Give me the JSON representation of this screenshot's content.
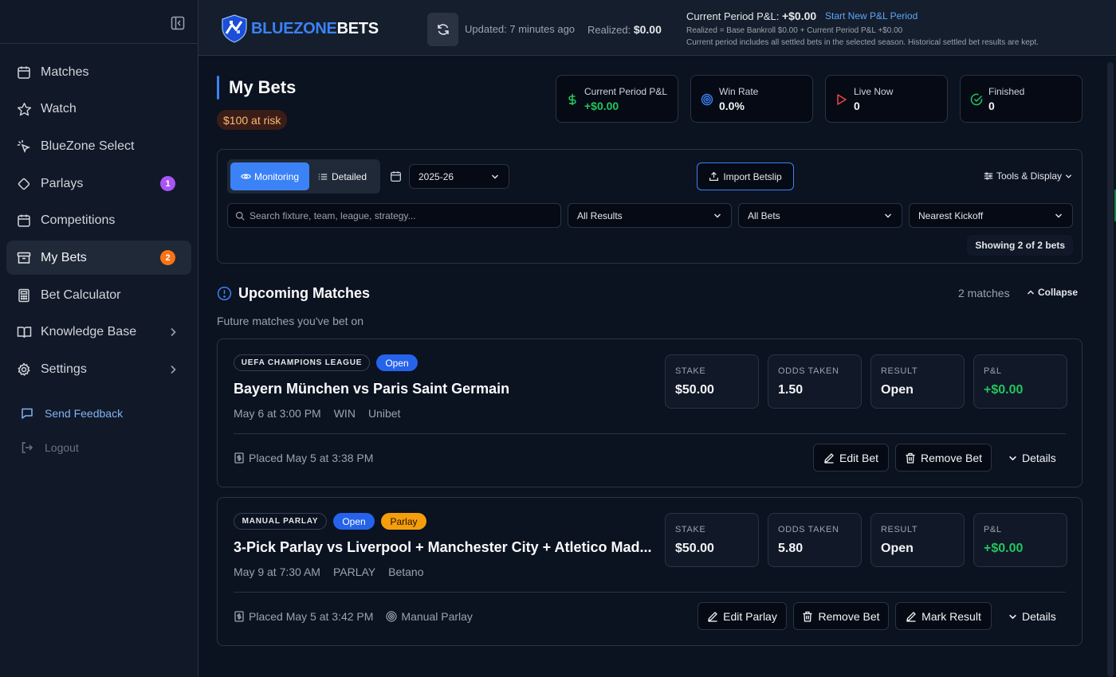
{
  "sidebar": {
    "items": [
      {
        "label": "Matches",
        "icon": "calendar-icon"
      },
      {
        "label": "Watch",
        "icon": "star-icon"
      },
      {
        "label": "BlueZone Select",
        "icon": "pointer-click-icon"
      },
      {
        "label": "Parlays",
        "icon": "diamond-icon",
        "badge": "1"
      },
      {
        "label": "Competitions",
        "icon": "calendar-icon"
      },
      {
        "label": "My Bets",
        "icon": "archive-icon",
        "badge": "2"
      },
      {
        "label": "Bet Calculator",
        "icon": "calculator-icon"
      },
      {
        "label": "Knowledge Base",
        "icon": "book-icon"
      },
      {
        "label": "Settings",
        "icon": "gear-icon"
      }
    ],
    "feedback": "Send Feedback",
    "logout": "Logout"
  },
  "header": {
    "logo_blue": "BLUEZONE",
    "logo_white": "BETS",
    "updated": "Updated: 7 minutes ago",
    "realized_label": "Realized:",
    "realized_value": "$0.00",
    "pnl_label": "Current Period P&L:",
    "pnl_value": "+$0.00",
    "new_period": "Start New P&L Period",
    "realized_formula": "Realized = Base Bankroll $0.00 + Current Period P&L +$0.00",
    "period_note": "Current period includes all settled bets in the selected season. Historical settled bet results are kept."
  },
  "page": {
    "title": "My Bets",
    "risk": "$100 at risk"
  },
  "stats": [
    {
      "label": "Current Period P&L",
      "value": "+$0.00",
      "icon": "dollar-icon"
    },
    {
      "label": "Win Rate",
      "value": "0.0%",
      "icon": "target-icon"
    },
    {
      "label": "Live Now",
      "value": "0",
      "icon": "play-icon"
    },
    {
      "label": "Finished",
      "value": "0",
      "icon": "check-circle-icon"
    }
  ],
  "filters": {
    "monitoring": "Monitoring",
    "detailed": "Detailed",
    "season": "2025-26",
    "import": "Import Betslip",
    "tools": "Tools & Display",
    "search_placeholder": "Search fixture, team, league, strategy...",
    "results": "All Results",
    "bets": "All Bets",
    "sort": "Nearest Kickoff",
    "showing": "Showing 2 of 2 bets"
  },
  "section": {
    "title": "Upcoming Matches",
    "subtitle": "Future matches you've bet on",
    "count": "2 matches",
    "collapse": "Collapse"
  },
  "metric_labels": {
    "stake": "STAKE",
    "odds": "ODDS TAKEN",
    "result": "RESULT",
    "pnl": "P&L"
  },
  "bets": [
    {
      "league": "UEFA CHAMPIONS LEAGUE",
      "status": "Open",
      "title": "Bayern München vs Paris Saint Germain",
      "date": "May 6 at 3:00 PM",
      "market": "WIN",
      "bookmaker": "Unibet",
      "stake": "$50.00",
      "odds": "1.50",
      "result": "Open",
      "pnl": "+$0.00",
      "placed": "Placed May 5 at 3:38 PM",
      "edit": "Edit Bet",
      "remove": "Remove Bet",
      "details": "Details"
    },
    {
      "league": "MANUAL PARLAY",
      "status": "Open",
      "type": "Parlay",
      "title": "3-Pick Parlay vs Liverpool + Manchester City + Atletico Mad...",
      "date": "May 9 at 7:30 AM",
      "market": "PARLAY",
      "bookmaker": "Betano",
      "stake": "$50.00",
      "odds": "5.80",
      "result": "Open",
      "pnl": "+$0.00",
      "placed": "Placed May 5 at 3:42 PM",
      "source": "Manual Parlay",
      "edit": "Edit Parlay",
      "remove": "Remove Bet",
      "mark": "Mark Result",
      "details": "Details"
    }
  ],
  "colors": {
    "accent": "#3b82f6",
    "positive": "#22c55e",
    "badge_purple": "#a855f7",
    "badge_orange": "#f97316",
    "parlay": "#f59e0b"
  }
}
